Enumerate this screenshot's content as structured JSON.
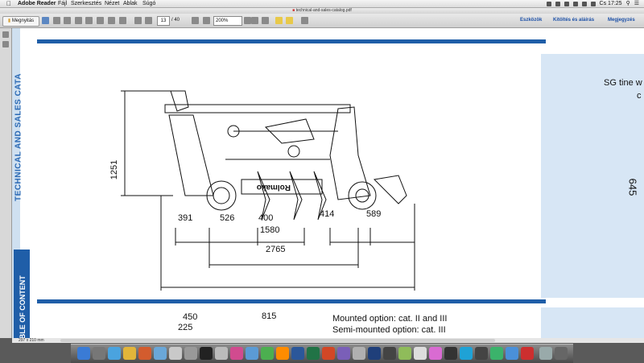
{
  "menubar": {
    "app": "Adobe Reader",
    "items": [
      "Fájl",
      "Szerkesztés",
      "Nézet",
      "Ablak",
      "Súgó"
    ],
    "clock": "Cs 17:25"
  },
  "window": {
    "title": "technical-and-sales-catalog.pdf"
  },
  "toolbar": {
    "open_label": "Megnyitás",
    "page_current": "13",
    "page_total": "/ 40",
    "zoom": "200%",
    "tools": "Eszközök",
    "fill_sign": "Kitöltés és aláírás",
    "comment": "Megjegyzés"
  },
  "document": {
    "side_title": "TECHNICAL AND SALES CATA",
    "toc_tab": "ABLE OF CONTENT",
    "panel_title": "SG tine w",
    "panel_sub": "c",
    "panel_number": "645",
    "drawing_brand": "Rolmako",
    "dimensions": {
      "height": "1251",
      "d391": "391",
      "d526": "526",
      "d400": "400",
      "d414": "414",
      "d589": "589",
      "d1580": "1580",
      "d2765": "2765",
      "d450": "450",
      "d225": "225",
      "d815": "815"
    },
    "mount_option_1": "Mounted option: cat. II and III",
    "mount_option_2": "Semi-mounted option: cat. III"
  },
  "status": {
    "page_size": "297 x 210 mm"
  }
}
